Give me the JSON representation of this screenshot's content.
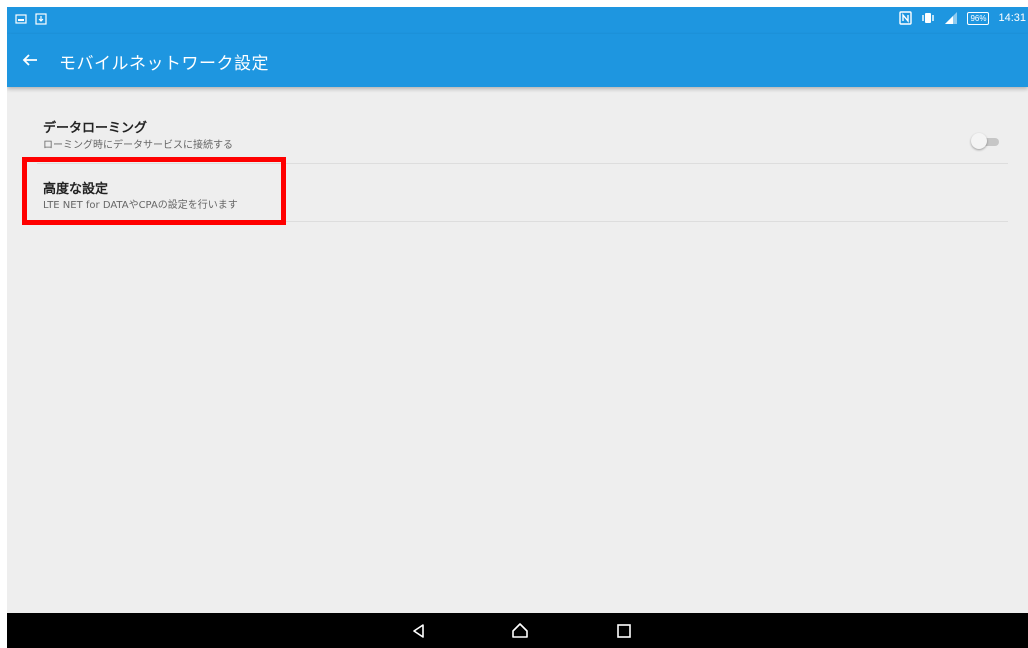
{
  "status_bar": {
    "time": "14:31",
    "battery": "96%",
    "icons": [
      "screenshot-icon",
      "download-icon",
      "nfc-icon",
      "vibrate-icon",
      "signal-icon",
      "battery-icon"
    ]
  },
  "app_bar": {
    "title": "モバイルネットワーク設定",
    "back_icon": "arrow-left-icon"
  },
  "settings": [
    {
      "title": "データローミング",
      "subtitle": "ローミング時にデータサービスに接続する",
      "toggle": {
        "on": false
      }
    },
    {
      "title": "高度な設定",
      "subtitle": "LTE NET for DATAやCPAの設定を行います"
    }
  ],
  "annotation": {
    "color": "#ff0000",
    "target": "高度な設定"
  },
  "colors": {
    "accent": "#1e96e0",
    "background": "#eeeeee",
    "navbar": "#000000"
  },
  "nav_bar": {
    "buttons": [
      "back-icon",
      "home-icon",
      "recents-icon"
    ]
  }
}
